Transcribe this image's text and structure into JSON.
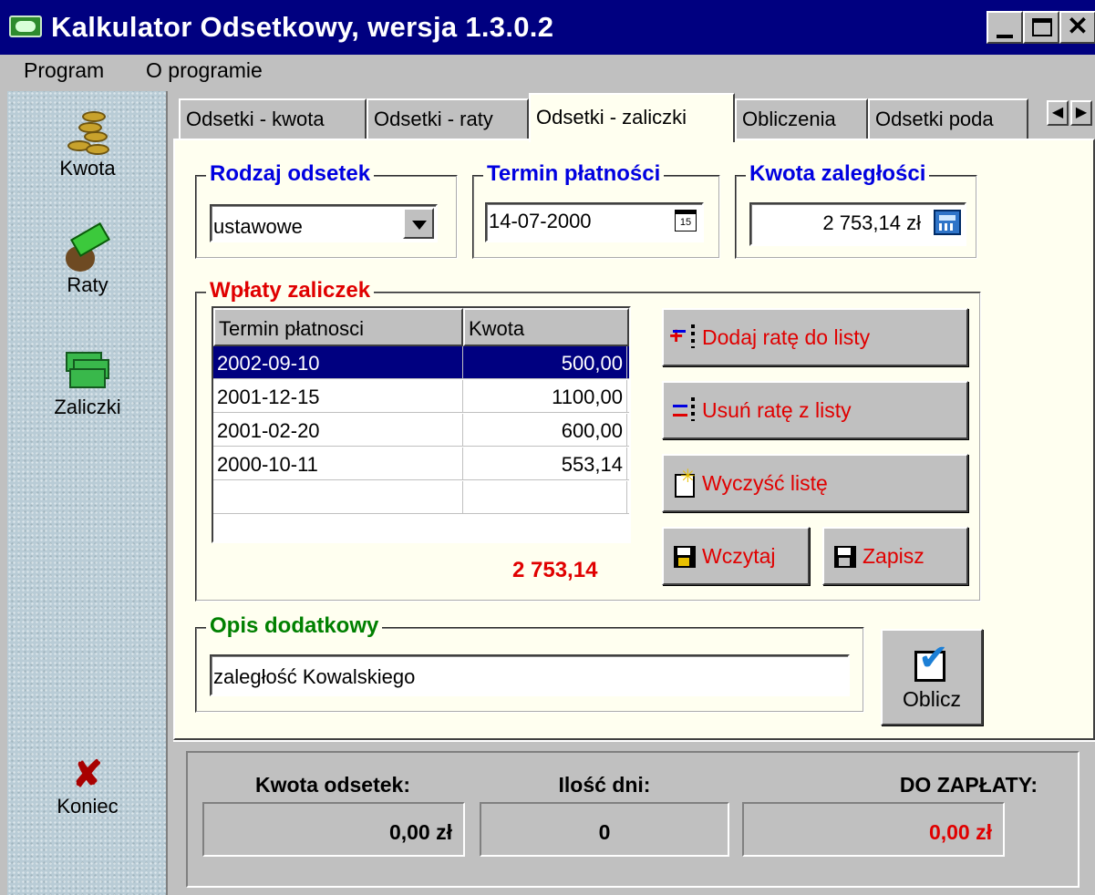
{
  "window": {
    "title": "Kalkulator Odsetkowy, wersja 1.3.0.2"
  },
  "menu": {
    "program": "Program",
    "about": "O programie"
  },
  "sidebar": {
    "items": [
      {
        "label": "Kwota",
        "icon": "coins-icon"
      },
      {
        "label": "Raty",
        "icon": "money-bag-icon"
      },
      {
        "label": "Zaliczki",
        "icon": "banknotes-icon"
      },
      {
        "label": "Koniec",
        "icon": "close-icon"
      }
    ]
  },
  "tabs": [
    {
      "label": "Odsetki - kwota"
    },
    {
      "label": "Odsetki - raty"
    },
    {
      "label": "Odsetki - zaliczki",
      "active": true
    },
    {
      "label": "Obliczenia"
    },
    {
      "label": "Odsetki poda"
    }
  ],
  "form": {
    "interest_type_title": "Rodzaj odsetek",
    "interest_type_value": "ustawowe",
    "due_date_title": "Termin płatności",
    "due_date_value": "14-07-2000",
    "calendar_icon_text": "15",
    "arrears_title": "Kwota zaległości",
    "arrears_value": "2 753,14 zł",
    "payments_title": "Wpłaty zaliczek",
    "table": {
      "headers": [
        "Termin płatnosci",
        "Kwota"
      ],
      "rows": [
        {
          "date": "2002-09-10",
          "amount": "500,00"
        },
        {
          "date": "2001-12-15",
          "amount": "1100,00"
        },
        {
          "date": "2001-02-20",
          "amount": "600,00"
        },
        {
          "date": "2000-10-11",
          "amount": "553,14"
        }
      ]
    },
    "total": "2 753,14",
    "buttons": {
      "add": "Dodaj ratę do listy",
      "remove": "Usuń ratę z listy",
      "clear": "Wyczyść listę",
      "load": "Wczytaj",
      "save": "Zapisz",
      "calculate": "Oblicz"
    },
    "description_title": "Opis dodatkowy",
    "description_value": "zaległość Kowalskiego"
  },
  "results": {
    "interest_label": "Kwota odsetek:",
    "interest_value": "0,00  zł",
    "days_label": "Ilość dni:",
    "days_value": "0",
    "total_label": "DO ZAPŁATY:",
    "total_value": "0,00  zł"
  },
  "colors": {
    "title_bar": "#000080",
    "panel_bg": "#fffff0",
    "blue_text": "#0000e0",
    "red_text": "#e00000",
    "green_text": "#008000"
  }
}
